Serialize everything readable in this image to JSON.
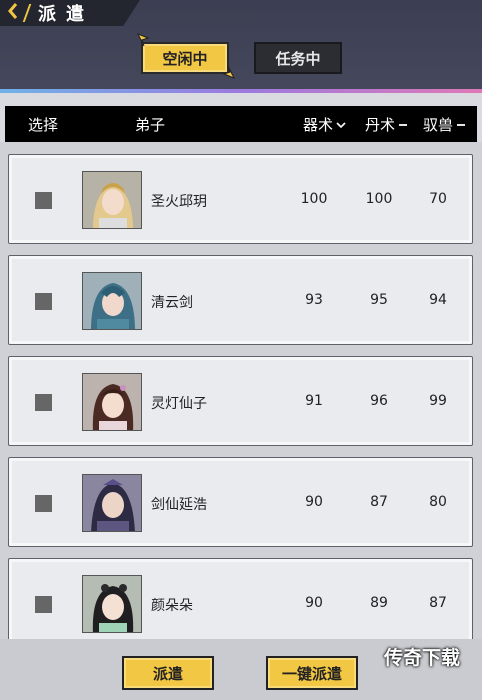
{
  "header": {
    "title": "派遣",
    "back_icon": "chevron-left-icon"
  },
  "tabs": [
    {
      "label": "空闲中",
      "active": true
    },
    {
      "label": "任务中",
      "active": false
    }
  ],
  "table": {
    "columns": {
      "select": "选择",
      "disciple": "弟子",
      "qishu": "器术",
      "danshu": "丹术",
      "yushou": "驭兽"
    },
    "sort_icons": {
      "qishu": "chevron-down-icon",
      "danshu": "minus-icon",
      "yushou": "minus-icon"
    },
    "rows": [
      {
        "name": "圣火邱玥",
        "qishu": "100",
        "danshu": "100",
        "yushou": "70"
      },
      {
        "name": "清云剑",
        "qishu": "93",
        "danshu": "95",
        "yushou": "94"
      },
      {
        "name": "灵灯仙子",
        "qishu": "91",
        "danshu": "96",
        "yushou": "99"
      },
      {
        "name": "剑仙延浩",
        "qishu": "90",
        "danshu": "87",
        "yushou": "80"
      },
      {
        "name": "颜朵朵",
        "qishu": "90",
        "danshu": "89",
        "yushou": "87"
      }
    ]
  },
  "buttons": {
    "dispatch": "派遣",
    "quick_dispatch": "一键派遣"
  },
  "watermark": "传奇下载",
  "colors": {
    "accent": "#f2c744",
    "header_bg": "#3c3e52",
    "checkbox": "#666666"
  }
}
